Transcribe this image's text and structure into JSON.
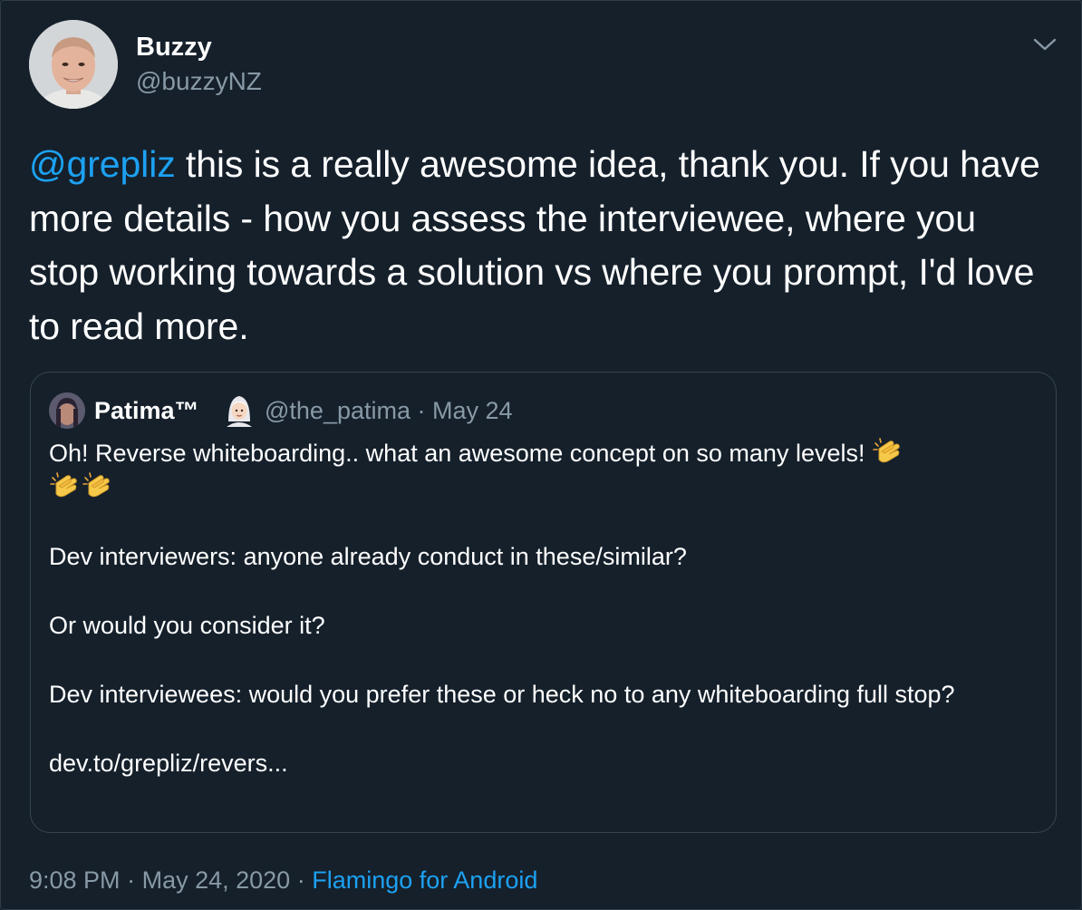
{
  "tweet": {
    "author": {
      "display_name": "Buzzy",
      "handle": "@buzzyNZ"
    },
    "mention": "@grepliz",
    "text": " this is a really awesome idea, thank you. If you have more details - how you assess the interviewee, where you stop working towards a solution vs where you prompt, I'd love to read more.",
    "time": "9:08 PM",
    "separator": "·",
    "date": "May 24, 2020",
    "source": "Flamingo for Android"
  },
  "quoted_tweet": {
    "author": {
      "display_name": "Patima™",
      "handle": "@the_patima",
      "emoji": "woman-with-headscarf-emoji"
    },
    "separator": "·",
    "date": "May 24",
    "line1": "Oh! Reverse whiteboarding.. what an awesome concept on so many levels!",
    "line2": "Dev interviewers: anyone already conduct in these/similar?",
    "line3": "Or would you consider it?",
    "line4": "Dev interviewees: would you prefer these or heck no to any whiteboarding full stop?",
    "link": "dev.to/grepliz/revers...",
    "clap_emoji": "clapping-hands-emoji"
  },
  "icons": {
    "menu": "chevron-down-icon"
  },
  "colors": {
    "background": "#15202b",
    "link": "#1da1f2",
    "secondary_text": "#8899a6",
    "border": "#38444d"
  }
}
